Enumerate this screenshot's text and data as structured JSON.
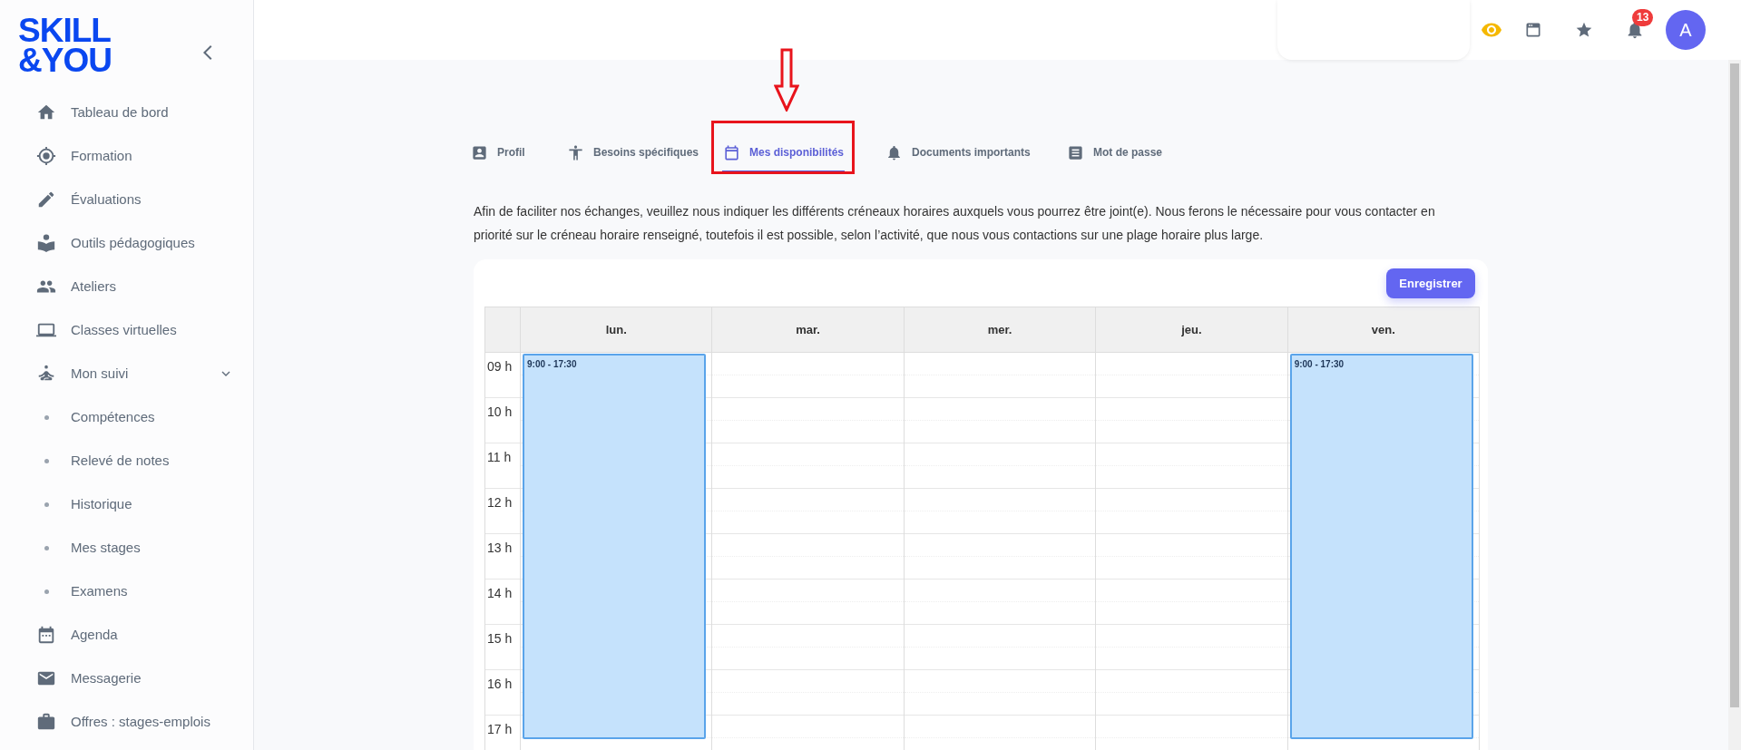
{
  "logo": {
    "lines": [
      "SKILL",
      "&YOU"
    ]
  },
  "sidebar": {
    "items": [
      {
        "label": "Tableau de bord",
        "kind": "item"
      },
      {
        "label": "Formation",
        "kind": "item"
      },
      {
        "label": "Évaluations",
        "kind": "item"
      },
      {
        "label": "Outils pédagogiques",
        "kind": "item"
      },
      {
        "label": "Ateliers",
        "kind": "item"
      },
      {
        "label": "Classes virtuelles",
        "kind": "item"
      },
      {
        "label": "Mon suivi",
        "kind": "group",
        "expanded": true,
        "children": [
          {
            "label": "Compétences",
            "kind": "subitem"
          },
          {
            "label": "Relevé de notes",
            "kind": "subitem"
          },
          {
            "label": "Historique",
            "kind": "subitem"
          },
          {
            "label": "Mes stages",
            "kind": "subitem"
          },
          {
            "label": "Examens",
            "kind": "subitem"
          }
        ]
      },
      {
        "label": "Agenda",
        "kind": "item"
      },
      {
        "label": "Messagerie",
        "kind": "item"
      },
      {
        "label": "Offres : stages-emplois",
        "kind": "item"
      }
    ]
  },
  "topbar": {
    "notifications": {
      "count": "13"
    },
    "avatar": {
      "initial": "A"
    }
  },
  "tabs": [
    {
      "label": "Profil",
      "selected": false
    },
    {
      "label": "Besoins spécifiques",
      "selected": false
    },
    {
      "label": "Mes disponibilités",
      "selected": true
    },
    {
      "label": "Documents importants",
      "selected": false
    },
    {
      "label": "Mot de passe",
      "selected": false
    }
  ],
  "intro": "Afin de faciliter nos échanges, veuillez nous indiquer les différents créneaux horaires auxquels vous pourrez être joint(e). Nous ferons le nécessaire pour vous contacter en priorité sur le créneau horaire renseigné, toutefois il est possible, selon l’activité, que nous vous contactions sur une plage horaire plus large.",
  "save_button": "Enregistrer",
  "calendar": {
    "days": [
      {
        "label": "lun.",
        "events": [
          {
            "label": "9:00 - 17:30"
          }
        ]
      },
      {
        "label": "mar."
      },
      {
        "label": "mer."
      },
      {
        "label": "jeu."
      },
      {
        "label": "ven.",
        "events": [
          {
            "label": "9:00 - 17:30"
          }
        ]
      }
    ],
    "hours": [
      "09 h",
      "10 h",
      "11 h",
      "12 h",
      "13 h",
      "14 h",
      "15 h",
      "16 h",
      "17 h"
    ]
  }
}
